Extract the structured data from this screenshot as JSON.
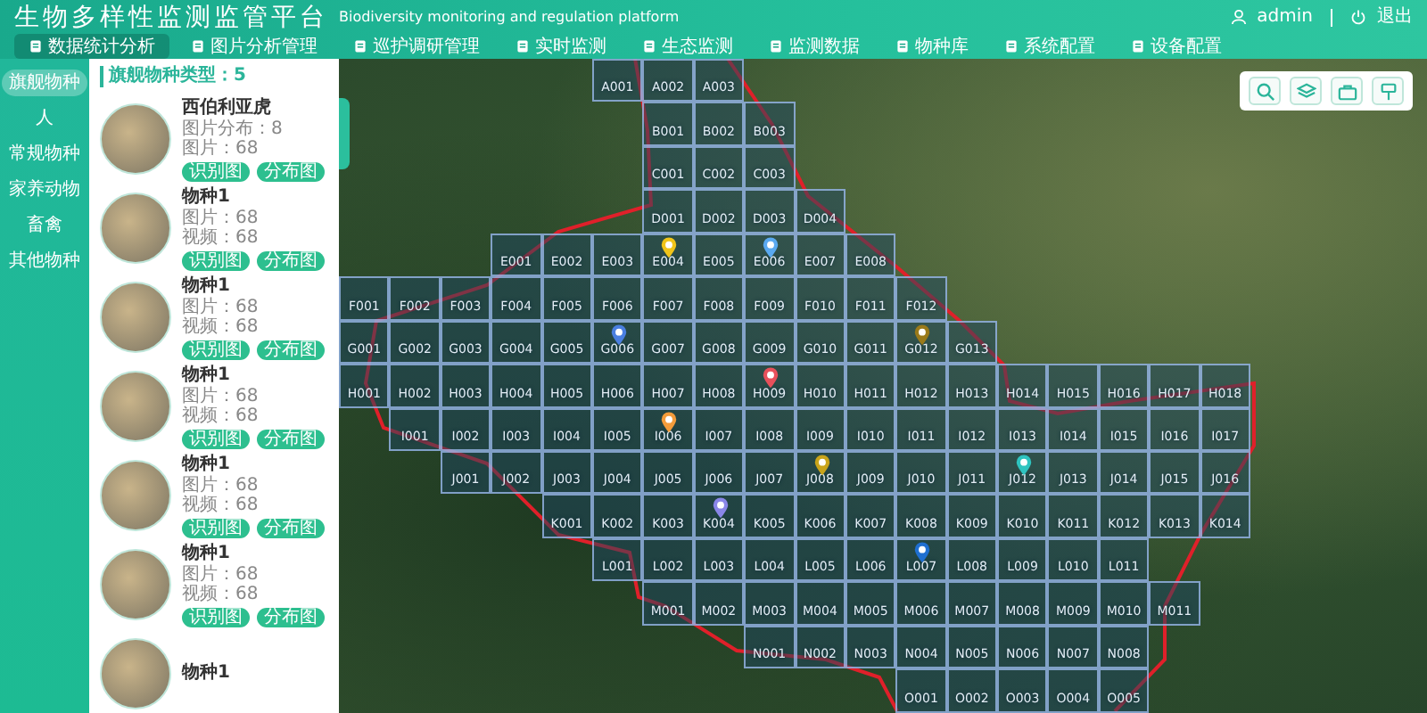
{
  "header": {
    "title": "生物多样性监测监管平台",
    "subtitle": "Biodiversity monitoring and regulation platform",
    "user": "admin",
    "logout": "退出"
  },
  "nav": [
    {
      "label": "数据统计分析",
      "selected": true
    },
    {
      "label": "图片分析管理",
      "selected": false
    },
    {
      "label": "巡护调研管理",
      "selected": false
    },
    {
      "label": "实时监测",
      "selected": false
    },
    {
      "label": "生态监测",
      "selected": false
    },
    {
      "label": "监测数据",
      "selected": false
    },
    {
      "label": "物种库",
      "selected": false
    },
    {
      "label": "系统配置",
      "selected": false
    },
    {
      "label": "设备配置",
      "selected": false
    }
  ],
  "sidebar": [
    {
      "label": "旗舰物种",
      "selected": true
    },
    {
      "label": "人",
      "selected": false
    },
    {
      "label": "常规物种",
      "selected": false
    },
    {
      "label": "家养动物",
      "selected": false
    },
    {
      "label": "畜禽",
      "selected": false
    },
    {
      "label": "其他物种",
      "selected": false
    }
  ],
  "panel": {
    "heading": "旗舰物种类型：5",
    "species": [
      {
        "name": "西伯利亚虎",
        "lines": [
          "图片分布：8",
          "图片：68"
        ],
        "buttons": [
          "识别图",
          "分布图"
        ]
      },
      {
        "name": "物种1",
        "lines": [
          "图片：68",
          "视频：68"
        ],
        "buttons": [
          "识别图",
          "分布图"
        ]
      },
      {
        "name": "物种1",
        "lines": [
          "图片：68",
          "视频：68"
        ],
        "buttons": [
          "识别图",
          "分布图"
        ]
      },
      {
        "name": "物种1",
        "lines": [
          "图片：68",
          "视频：68"
        ],
        "buttons": [
          "识别图",
          "分布图"
        ]
      },
      {
        "name": "物种1",
        "lines": [
          "图片：68",
          "视频：68"
        ],
        "buttons": [
          "识别图",
          "分布图"
        ]
      },
      {
        "name": "物种1",
        "lines": [
          "图片：68",
          "视频：68"
        ],
        "buttons": [
          "识别图",
          "分布图"
        ]
      },
      {
        "name": "物种1"
      }
    ]
  },
  "map": {
    "rows": [
      [
        null,
        null,
        null,
        null,
        null,
        "A001",
        "A002",
        "A003",
        null,
        null,
        null,
        null,
        null,
        null,
        null,
        null,
        null,
        null
      ],
      [
        null,
        null,
        null,
        null,
        null,
        null,
        "B001",
        "B002",
        "B003",
        null,
        null,
        null,
        null,
        null,
        null,
        null,
        null,
        null
      ],
      [
        null,
        null,
        null,
        null,
        null,
        null,
        "C001",
        "C002",
        "C003",
        null,
        null,
        null,
        null,
        null,
        null,
        null,
        null,
        null
      ],
      [
        null,
        null,
        null,
        null,
        null,
        null,
        "D001",
        "D002",
        "D003",
        "D004",
        null,
        null,
        null,
        null,
        null,
        null,
        null,
        null
      ],
      [
        null,
        null,
        null,
        "E001",
        "E002",
        "E003",
        {
          "label": "E004",
          "pin": {
            "color": "#f0c419"
          }
        },
        "E005",
        {
          "label": "E006",
          "pin": {
            "color": "#5aa9f0"
          }
        },
        "E007",
        "E008",
        null,
        null,
        null,
        null,
        null,
        null,
        null
      ],
      [
        "F001",
        "F002",
        "F003",
        "F004",
        "F005",
        "F006",
        "F007",
        "F008",
        "F009",
        "F010",
        "F011",
        "F012",
        null,
        null,
        null,
        null,
        null,
        null
      ],
      [
        "G001",
        "G002",
        "G003",
        "G004",
        "G005",
        {
          "label": "G006",
          "pin": {
            "color": "#4a7fe0"
          }
        },
        "G007",
        "G008",
        "G009",
        "G010",
        "G011",
        {
          "label": "G012",
          "pin": {
            "color": "#9a7a1a"
          }
        },
        "G013",
        null,
        null,
        null,
        null,
        null
      ],
      [
        "H001",
        "H002",
        "H003",
        "H004",
        "H005",
        "H006",
        "H007",
        "H008",
        {
          "label": "H009",
          "pin": {
            "color": "#e8505b"
          }
        },
        "H010",
        "H011",
        "H012",
        "H013",
        "H014",
        "H015",
        "H016",
        "H017",
        "H018"
      ],
      [
        null,
        "I001",
        "I002",
        "I003",
        "I004",
        "I005",
        {
          "label": "I006",
          "pin": {
            "color": "#f39c3b"
          }
        },
        "I007",
        "I008",
        "I009",
        "I010",
        "I011",
        "I012",
        "I013",
        "I014",
        "I015",
        "I016",
        "I017"
      ],
      [
        null,
        null,
        "J001",
        "J002",
        "J003",
        "J004",
        "J005",
        "J006",
        "J007",
        {
          "label": "J008",
          "pin": {
            "color": "#c9a41a"
          }
        },
        "J009",
        "J010",
        "J011",
        {
          "label": "J012",
          "pin": {
            "color": "#2fc4c0"
          }
        },
        "J013",
        "J014",
        "J015",
        "J016"
      ],
      [
        null,
        null,
        null,
        null,
        "K001",
        "K002",
        "K003",
        {
          "label": "K004",
          "pin": {
            "color": "#8a86e8"
          }
        },
        "K005",
        "K006",
        "K007",
        "K008",
        "K009",
        "K010",
        "K011",
        "K012",
        "K013",
        "K014"
      ],
      [
        null,
        null,
        null,
        null,
        null,
        "L001",
        "L002",
        "L003",
        "L004",
        "L005",
        "L006",
        {
          "label": "L007",
          "pin": {
            "color": "#1f6fd0"
          }
        },
        "L008",
        "L009",
        "L010",
        "L011",
        null,
        null
      ],
      [
        null,
        null,
        null,
        null,
        null,
        null,
        "M001",
        "M002",
        "M003",
        "M004",
        "M005",
        "M006",
        "M007",
        "M008",
        "M009",
        "M010",
        "M011",
        null
      ],
      [
        null,
        null,
        null,
        null,
        null,
        null,
        null,
        null,
        "N001",
        "N002",
        "N003",
        "N004",
        "N005",
        "N006",
        "N007",
        "N008",
        null,
        null
      ],
      [
        null,
        null,
        null,
        null,
        null,
        null,
        null,
        null,
        null,
        null,
        null,
        "O001",
        "O002",
        "O003",
        "O004",
        "O005",
        null,
        null
      ]
    ]
  }
}
